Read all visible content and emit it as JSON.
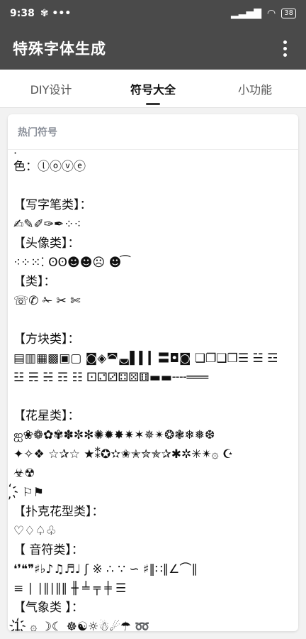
{
  "status": {
    "time": "9:38",
    "left_icons": "✾ •••",
    "signal": "▂▃▅▇",
    "wifi": "◠",
    "battery": "38"
  },
  "app": {
    "title": "特殊字体生成",
    "menu_icon": "more-vert-icon"
  },
  "tabs": [
    {
      "label": "DIY设计",
      "active": false
    },
    {
      "label": "符号大全",
      "active": true
    },
    {
      "label": "小功能",
      "active": false
    }
  ],
  "card": {
    "header": "热门符号",
    "cut_text": "·  ˜  ˜  ˜  ˜  ˜  ˜  ˜  ˜",
    "lines": [
      "色：ⓛⓞⓥⓔ",
      "",
      "【写字笔类】：",
      "✍✎✐✑✒⁘⁖",
      "【头像类】：",
      "⁖⁘⁙⁚ ʘʘ☻☻☹ ☻ ͡",
      "【类】：",
      "☏✆ ✁ ✂ ✄",
      "",
      "【方块类】：",
      "▤▥▦▩▣▢ ◙◈◚◛▌▍▎〓◘◙ ❏❐❑❒☰ ☱ ☲",
      "☳ ☴ ☵ ☶ ☷ ⚀⚁⚂⚃⚄⚅▬▬╌╌═══",
      "",
      "  【花星类】：",
      "ஐ❀❁✿✾✽✼✻✺✹✸✷✶✵✴❂❃❄❅❆",
      "✦✧❖ ☆✰☆ ★⁑✪✫✬✭✮✯✰✱✲✳✴۞ ☪",
      "☣☢",
      "҉ ⚐⚑",
      " 【扑克花型类】：",
      "♡♢♤♧",
      "【 音符类】：",
      "❛❜❝❞♯♭♪♫♬♩ ʃ ※ ∴ ∵ ∽ ♯‖∷∥∠⌒∥",
      "≡ ∣ ∣∥∣∥∥ ╫ ╧ ╤ ╪ ☰",
      "【气象类 】：",
      "1҉ ۞ ☽☾ ☸☯☼☃☄☂ ➿"
    ]
  }
}
